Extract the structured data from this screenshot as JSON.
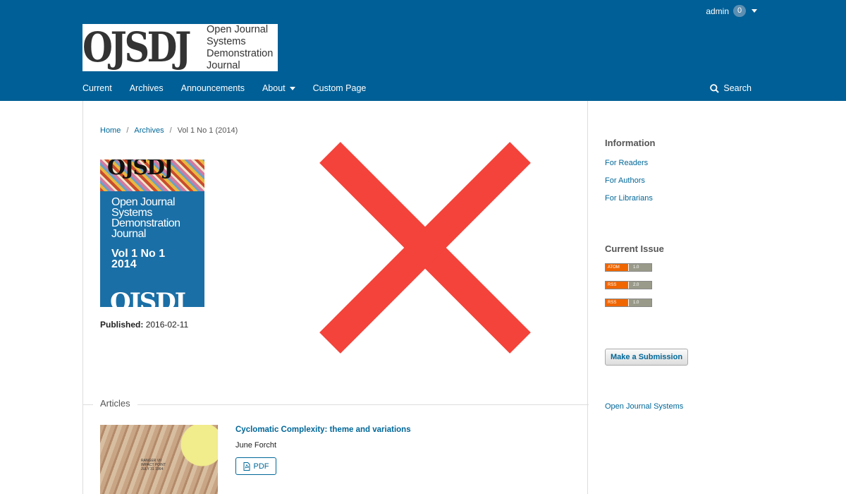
{
  "header": {
    "user": {
      "name": "admin",
      "notifications": "0"
    },
    "logo": {
      "mark": "OJSDJ",
      "words": [
        "Open Journal",
        "Systems",
        "Demonstration",
        "Journal"
      ]
    },
    "nav": {
      "current": "Current",
      "archives": "Archives",
      "announcements": "Announcements",
      "about": "About",
      "custom_page": "Custom Page"
    },
    "search_label": "Search"
  },
  "breadcrumb": {
    "home": "Home",
    "sep": "/",
    "archives": "Archives",
    "current": "Vol 1 No 1 (2014)"
  },
  "issue": {
    "cover": {
      "top_text": "OJSDJ",
      "title_lines": [
        "Open Journal",
        "Systems",
        "Demonstration",
        "Journal"
      ],
      "issue_lines": [
        "Vol 1 No 1",
        "2014"
      ],
      "bottom_text": "OJSDJ"
    },
    "published_label": "Published:",
    "published_date": "2016-02-11"
  },
  "articles": {
    "section_label": "Articles",
    "items": [
      {
        "title": "Cyclomatic Complexity: theme and variations",
        "author": "June Forcht",
        "galley_label": "PDF",
        "thumb_text": [
          "RANGER VII",
          "IMPACT POINT",
          "JULY 31 1964"
        ]
      }
    ]
  },
  "sidebar": {
    "information": {
      "heading": "Information",
      "links": [
        "For Readers",
        "For Authors",
        "For Librarians"
      ]
    },
    "current_issue": {
      "heading": "Current Issue",
      "feeds": [
        {
          "type": "ATOM",
          "version": "1.0"
        },
        {
          "type": "RSS",
          "version": "2.0"
        },
        {
          "type": "RSS",
          "version": "1.0"
        }
      ]
    },
    "submit_label": "Make a Submission",
    "ojs_link": "Open Journal Systems"
  },
  "colors": {
    "header_bg": "#005f96",
    "link": "#006798",
    "overlay_cross": "#f4433a"
  },
  "icons": {
    "search": "search-icon",
    "pdf": "pdf-icon",
    "close_overlay": "close-x-icon"
  }
}
